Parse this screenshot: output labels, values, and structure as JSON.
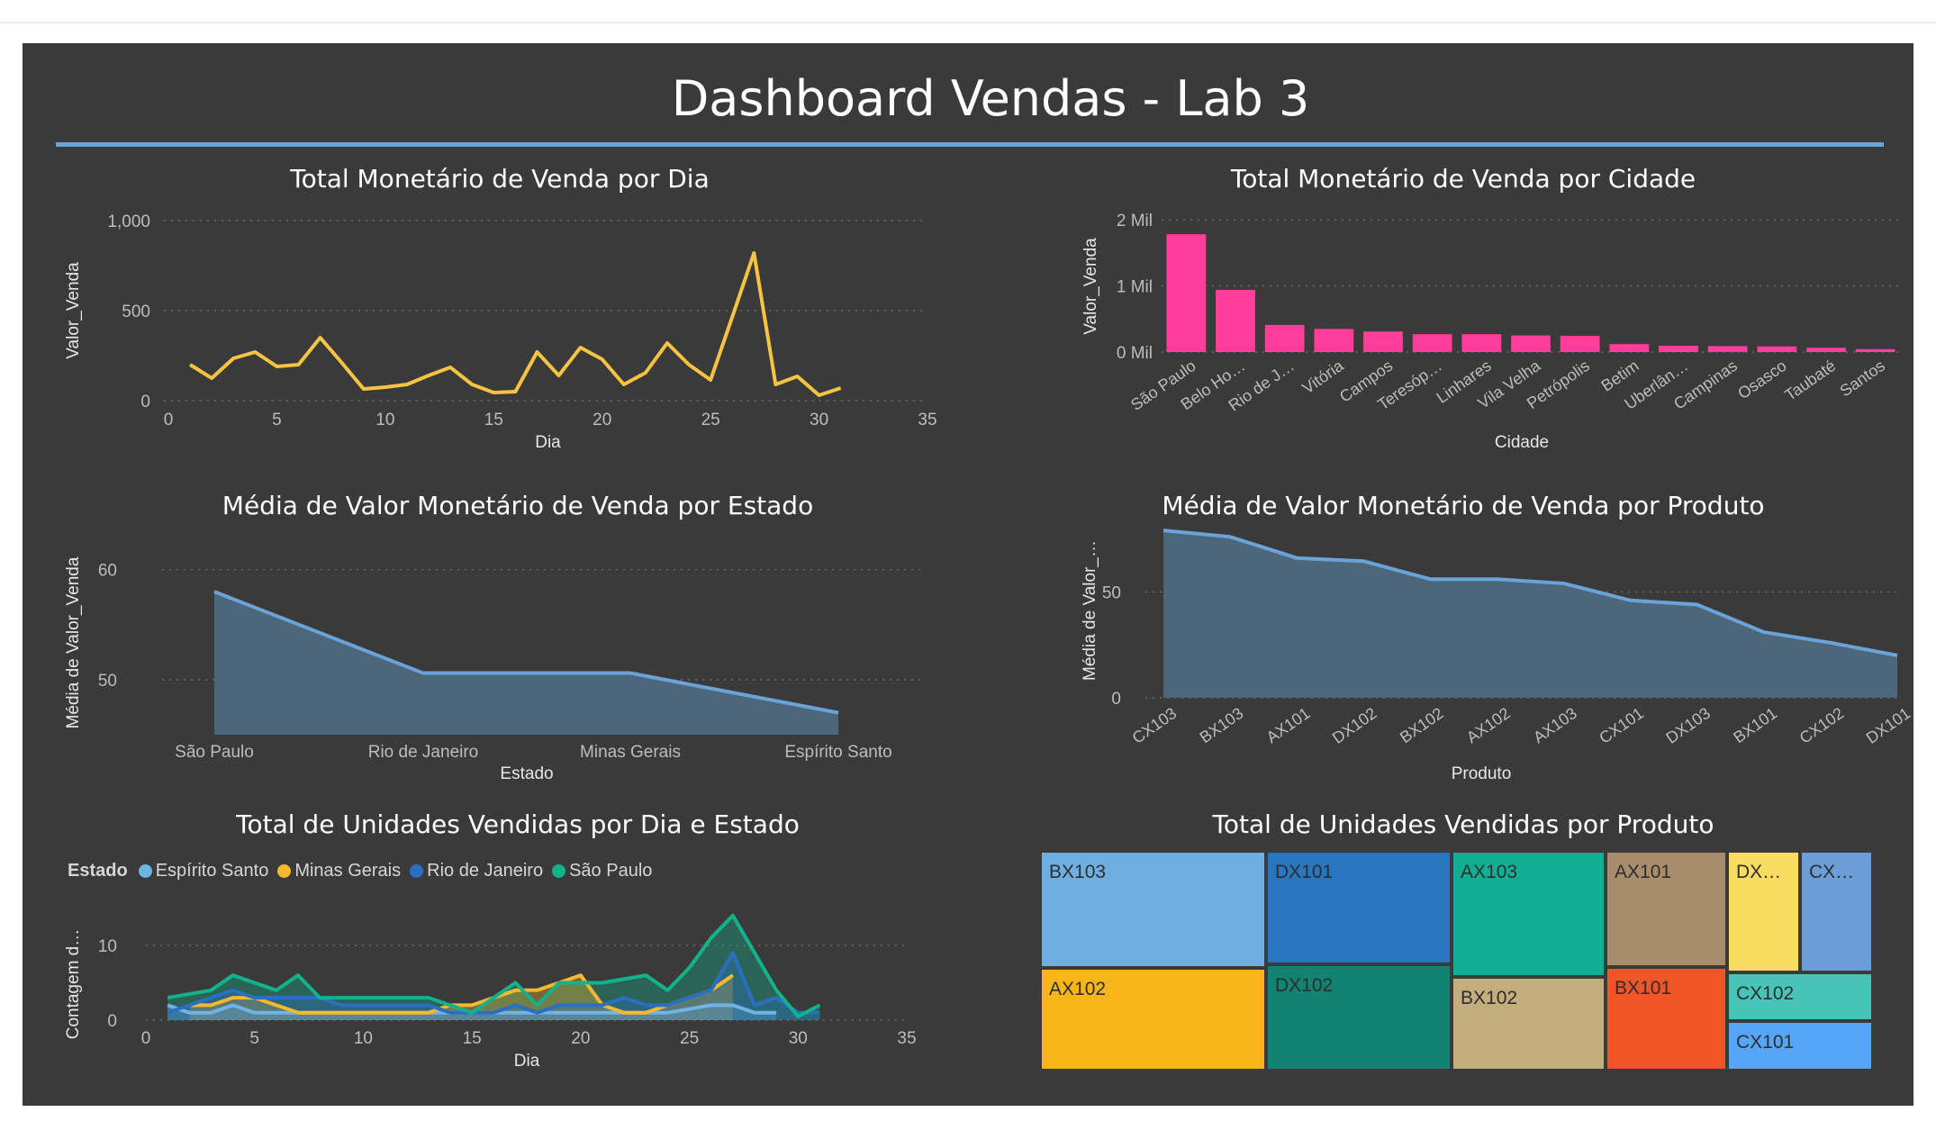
{
  "dashboard": {
    "title": "Dashboard Vendas - Lab 3"
  },
  "colors": {
    "background": "#3a3a3a",
    "accent_rule": "#6aa3d8",
    "line_day": "#f6c342",
    "bar_city": "#ff3d9a",
    "area": "#6aa3d8",
    "espirito_santo": "#6fb4e3",
    "minas_gerais": "#f5b82e",
    "rio_de_janeiro": "#2b6fc2",
    "sao_paulo": "#12b38c"
  },
  "chart_data": [
    {
      "id": "venda_dia",
      "type": "line",
      "title": "Total Monetário de Venda por Dia",
      "xlabel": "Dia",
      "ylabel": "Valor_Venda",
      "xlim": [
        0,
        35
      ],
      "ylim": [
        0,
        1000
      ],
      "xticks": [
        "0",
        "5",
        "10",
        "15",
        "20",
        "25",
        "30",
        "35"
      ],
      "yticks": [
        "0",
        "500",
        "1,000"
      ],
      "grid": true,
      "x": [
        1,
        2,
        3,
        4,
        5,
        6,
        7,
        8,
        9,
        10,
        11,
        12,
        13,
        14,
        15,
        16,
        17,
        18,
        19,
        20,
        21,
        22,
        23,
        24,
        25,
        26,
        27,
        28,
        29,
        30,
        31
      ],
      "values": [
        200,
        125,
        235,
        270,
        190,
        200,
        350,
        210,
        65,
        75,
        90,
        140,
        185,
        90,
        45,
        50,
        270,
        140,
        295,
        230,
        90,
        155,
        320,
        200,
        115,
        465,
        820,
        90,
        135,
        30,
        70
      ]
    },
    {
      "id": "venda_cidade",
      "type": "bar",
      "title": "Total Monetário de Venda por Cidade",
      "xlabel": "Cidade",
      "ylabel": "Valor_Venda",
      "yticks": [
        "0 Mil",
        "1 Mil",
        "2 Mil"
      ],
      "ylim": [
        0,
        2000
      ],
      "grid": true,
      "categories": [
        "São Paulo",
        "Belo Ho…",
        "Rio de J…",
        "Vitória",
        "Campos",
        "Teresóp…",
        "Linhares",
        "Vila Velha",
        "Petrópolis",
        "Betim",
        "Uberlân…",
        "Campinas",
        "Osasco",
        "Taubaté",
        "Santos"
      ],
      "values": [
        1780,
        940,
        410,
        350,
        310,
        270,
        270,
        250,
        245,
        120,
        95,
        90,
        85,
        65,
        45
      ]
    },
    {
      "id": "media_estado",
      "type": "area",
      "title": "Média de Valor Monetário de Venda por Estado",
      "xlabel": "Estado",
      "ylabel": "Média de Valor_Venda",
      "ylim": [
        45,
        63
      ],
      "yticks": [
        "50",
        "60"
      ],
      "grid": true,
      "categories": [
        "São Paulo",
        "Rio de Janeiro",
        "Minas Gerais",
        "Espírito Santo"
      ],
      "values": [
        58,
        50.6,
        50.6,
        47
      ]
    },
    {
      "id": "media_produto",
      "type": "area",
      "title": "Média de Valor Monetário de Venda por Produto",
      "xlabel": "Produto",
      "ylabel": "Média de Valor_…",
      "ylim": [
        0,
        85
      ],
      "yticks": [
        "0",
        "50"
      ],
      "grid": true,
      "categories": [
        "CX103",
        "BX103",
        "AX101",
        "DX102",
        "BX102",
        "AX102",
        "AX103",
        "CX101",
        "DX103",
        "BX101",
        "CX102",
        "DX101"
      ],
      "values": [
        79,
        76,
        66,
        64.5,
        56,
        56,
        54,
        46,
        44,
        31,
        26,
        20
      ]
    },
    {
      "id": "unidades_dia_estado",
      "type": "area",
      "title": "Total de Unidades Vendidas por Dia e Estado",
      "xlabel": "Dia",
      "ylabel": "Contagem d…",
      "legend_title": "Estado",
      "legend_position": "top-left",
      "xlim": [
        0,
        35
      ],
      "ylim": [
        0,
        17
      ],
      "xticks": [
        "0",
        "5",
        "10",
        "15",
        "20",
        "25",
        "30",
        "35"
      ],
      "yticks": [
        "0",
        "10"
      ],
      "grid": true,
      "series": [
        {
          "name": "Espírito Santo",
          "color": "#6fb4e3",
          "x": [
            1,
            2,
            3,
            4,
            5,
            6,
            7,
            8,
            9,
            10,
            11,
            12,
            13,
            14,
            15,
            16,
            17,
            18,
            19,
            20,
            21,
            22,
            23,
            24,
            25,
            26,
            27,
            28,
            29
          ],
          "values": [
            2,
            1,
            1,
            2,
            1,
            1,
            1,
            1,
            1,
            1,
            1,
            1,
            1,
            1,
            1,
            1,
            1,
            1,
            1,
            1,
            1,
            1,
            1,
            1,
            1.5,
            2,
            2,
            1,
            1
          ]
        },
        {
          "name": "Minas Gerais",
          "color": "#f5b82e",
          "x": [
            2,
            3,
            4,
            5,
            6,
            7,
            8,
            9,
            10,
            11,
            12,
            13,
            14,
            15,
            16,
            17,
            18,
            19,
            20,
            21,
            22,
            23,
            24,
            25,
            26,
            27
          ],
          "values": [
            2,
            2,
            3,
            3,
            2,
            1,
            1,
            1,
            1,
            1,
            1,
            1,
            2,
            2,
            3,
            4,
            4,
            5,
            6,
            2,
            1,
            1,
            2,
            3,
            4,
            6
          ]
        },
        {
          "name": "Rio de Janeiro",
          "color": "#2b6fc2",
          "x": [
            1,
            2,
            3,
            4,
            5,
            6,
            7,
            8,
            9,
            10,
            11,
            12,
            13,
            14,
            15,
            16,
            17,
            18,
            19,
            20,
            21,
            22,
            23,
            24,
            25,
            26,
            27,
            28,
            29,
            30,
            31
          ],
          "values": [
            1,
            2,
            3,
            4,
            3,
            3,
            3,
            3,
            2,
            2,
            2,
            2,
            2,
            1,
            1,
            1,
            2,
            1,
            2,
            2,
            2,
            3,
            2,
            2,
            3,
            4,
            9,
            2,
            3,
            1,
            1
          ]
        },
        {
          "name": "São Paulo",
          "color": "#12b38c",
          "x": [
            1,
            2,
            3,
            4,
            5,
            6,
            7,
            8,
            9,
            10,
            11,
            12,
            13,
            14,
            15,
            16,
            17,
            18,
            19,
            20,
            21,
            22,
            23,
            24,
            25,
            26,
            27,
            28,
            29,
            30,
            31
          ],
          "values": [
            3,
            3.5,
            4,
            6,
            5,
            4,
            6,
            3,
            3,
            3,
            3,
            3,
            3,
            2,
            1,
            3,
            5,
            2,
            5,
            5,
            5,
            5.5,
            6,
            4,
            7,
            11,
            14,
            9,
            4,
            0.5,
            2
          ]
        }
      ]
    },
    {
      "id": "unidades_produto",
      "type": "treemap",
      "title": "Total de Unidades Vendidas por Produto",
      "categories": [
        "BX103",
        "AX102",
        "DX101",
        "DX102",
        "AX103",
        "BX102",
        "AX101",
        "BX101",
        "DX…",
        "CX…",
        "CX102",
        "CX101"
      ],
      "colors": [
        "#6faee0",
        "#f7b519",
        "#2a75c0",
        "#128372",
        "#11ae94",
        "#c3ad7c",
        "#a98c6c",
        "#ef5528",
        "#fbdc63",
        "#6b9ed8",
        "#48c3b8",
        "#55a6fa"
      ]
    }
  ]
}
